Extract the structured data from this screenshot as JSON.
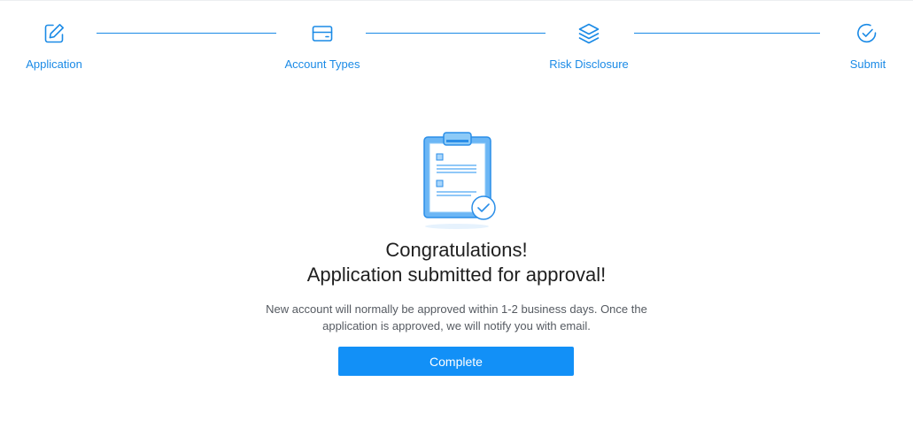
{
  "steps": [
    {
      "label": "Application",
      "icon": "edit-icon"
    },
    {
      "label": "Account Types",
      "icon": "card-icon"
    },
    {
      "label": "Risk Disclosure",
      "icon": "layers-icon"
    },
    {
      "label": "Submit",
      "icon": "check-circle-icon"
    }
  ],
  "colors": {
    "accent": "#1290f7",
    "step": "#1a8ae6",
    "text": "#1f1f1f",
    "muted": "#555a61"
  },
  "result": {
    "illustration_icon": "clipboard-check-icon",
    "title_line1": "Congratulations!",
    "title_line2": "Application submitted for approval!",
    "description": "New account will normally be approved within 1-2 business days. Once the application is approved, we will notify you with email."
  },
  "actions": {
    "complete_label": "Complete"
  }
}
